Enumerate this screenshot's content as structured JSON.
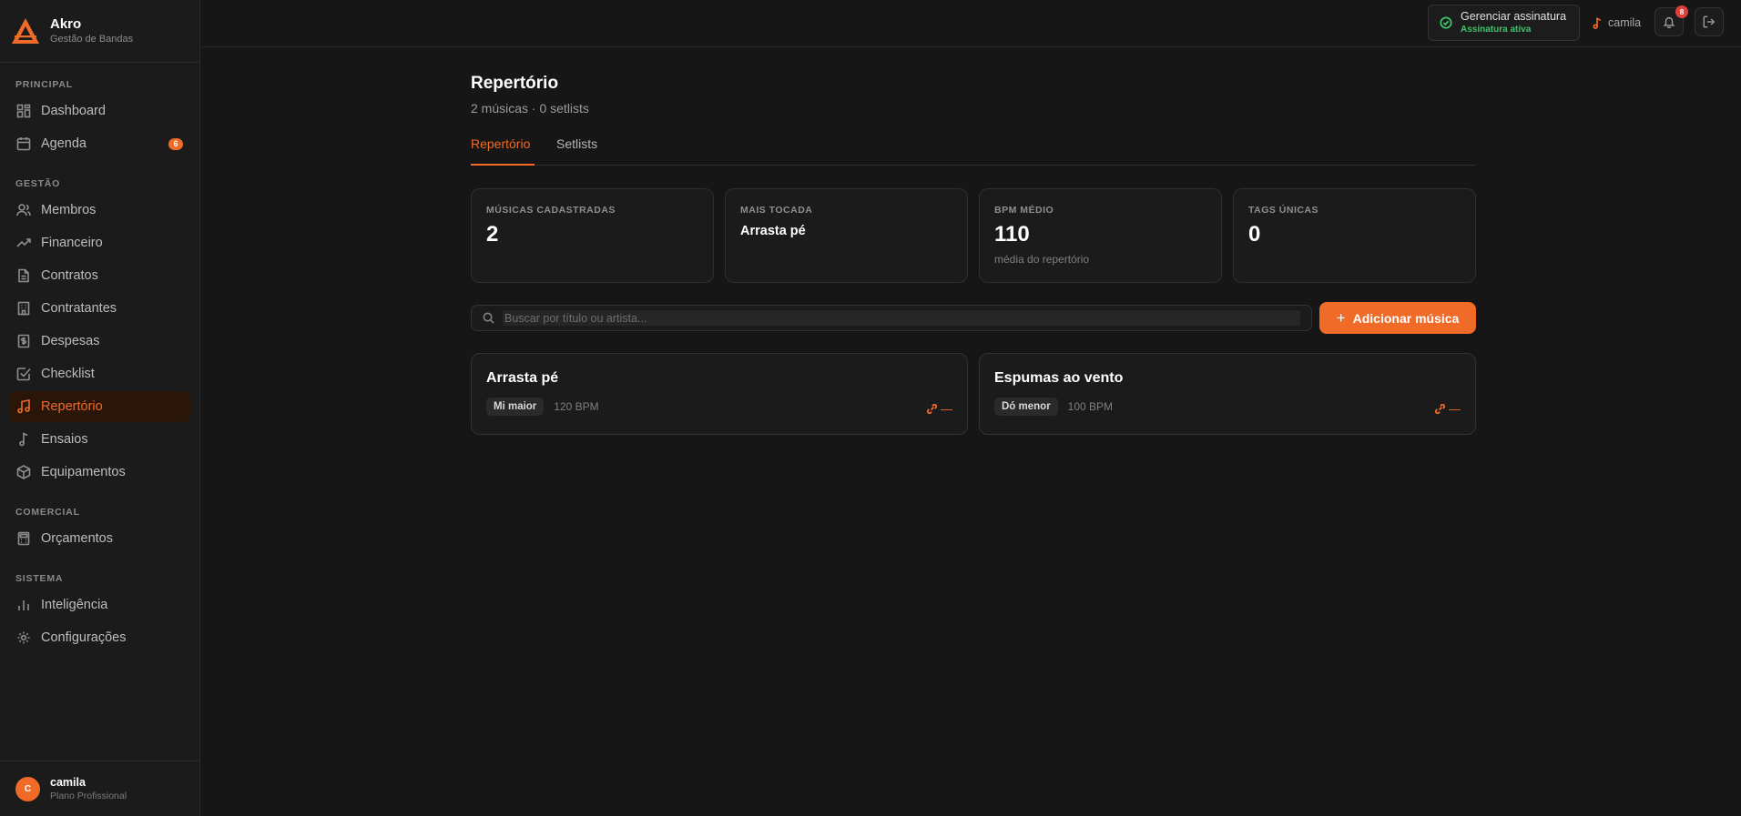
{
  "brand": {
    "name": "Akro",
    "subtitle": "Gestão de Bandas"
  },
  "sidebar": {
    "sections": [
      {
        "label": "PRINCIPAL",
        "items": [
          {
            "label": "Dashboard",
            "icon": "grid-icon"
          },
          {
            "label": "Agenda",
            "icon": "calendar-icon",
            "badge": "6"
          }
        ]
      },
      {
        "label": "GESTÃO",
        "items": [
          {
            "label": "Membros",
            "icon": "users-icon"
          },
          {
            "label": "Financeiro",
            "icon": "trending-up-icon"
          },
          {
            "label": "Contratos",
            "icon": "file-icon"
          },
          {
            "label": "Contratantes",
            "icon": "building-icon"
          },
          {
            "label": "Despesas",
            "icon": "receipt-icon"
          },
          {
            "label": "Checklist",
            "icon": "checkbox-icon"
          },
          {
            "label": "Repertório",
            "icon": "music-icon",
            "active": true
          },
          {
            "label": "Ensaios",
            "icon": "note-icon"
          },
          {
            "label": "Equipamentos",
            "icon": "package-icon"
          }
        ]
      },
      {
        "label": "COMERCIAL",
        "items": [
          {
            "label": "Orçamentos",
            "icon": "calculator-icon"
          }
        ]
      },
      {
        "label": "SISTEMA",
        "items": [
          {
            "label": "Inteligência",
            "icon": "bar-chart-icon"
          },
          {
            "label": "Configurações",
            "icon": "gear-icon"
          }
        ]
      }
    ],
    "user": {
      "initial": "C",
      "name": "camila",
      "plan": "Plano Profissional"
    }
  },
  "topbar": {
    "subscription": {
      "title": "Gerenciar assinatura",
      "status": "Assinatura ativa"
    },
    "username": "camila",
    "notifications": "8"
  },
  "page": {
    "title": "Repertório",
    "subtitle": "2 músicas · 0 setlists",
    "tabs": [
      {
        "label": "Repertório",
        "active": true
      },
      {
        "label": "Setlists"
      }
    ]
  },
  "stats": [
    {
      "label": "MÚSICAS CADASTRADAS",
      "value": "2"
    },
    {
      "label": "MAIS TOCADA",
      "value": "Arrasta pé"
    },
    {
      "label": "BPM MÉDIO",
      "value": "110",
      "note": "média do repertório"
    },
    {
      "label": "TAGS ÚNICAS",
      "value": "0"
    }
  ],
  "search": {
    "placeholder": "Buscar por título ou artista..."
  },
  "add_button": "Adicionar música",
  "songs": [
    {
      "title": "Arrasta pé",
      "key": "Mi maior",
      "bpm": "120 BPM",
      "link": "—"
    },
    {
      "title": "Espumas ao vento",
      "key": "Dó menor",
      "bpm": "100 BPM",
      "link": "—"
    }
  ],
  "colors": {
    "accent": "#f06a28",
    "success": "#3ec46d",
    "background": "#161616",
    "sidebar": "#1b1b1b"
  }
}
